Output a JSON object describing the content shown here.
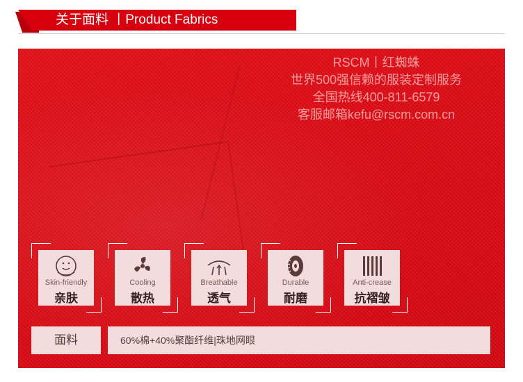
{
  "header": {
    "title": "关于面料 丨Product Fabrics"
  },
  "watermark": {
    "line1": "RSCM丨红蜘蛛",
    "line2": "世界500强信赖的服装定制服务",
    "line3": "全国热线400-811-6579",
    "line4": "客服邮箱kefu@rscm.com.cn"
  },
  "features": [
    {
      "en": "Skin-friendly",
      "cn": "亲肤",
      "icon": "baby-icon"
    },
    {
      "en": "Cooling",
      "cn": "散热",
      "icon": "fan-icon"
    },
    {
      "en": "Breathable",
      "cn": "透气",
      "icon": "breathable-icon"
    },
    {
      "en": "Durable",
      "cn": "耐磨",
      "icon": "tire-icon"
    },
    {
      "en": "Anti-crease",
      "cn": "抗褶皱",
      "icon": "stripes-icon"
    }
  ],
  "material": {
    "label": "面料",
    "value": "60%棉+40%聚酯纤维|珠地网眼"
  },
  "colors": {
    "brand_red": "#d7000f",
    "fabric_red": "#e20c16",
    "card_bg": "#f2dcdc"
  }
}
